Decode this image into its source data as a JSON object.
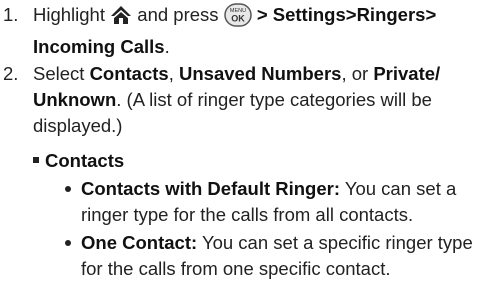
{
  "steps": [
    {
      "number": "1.",
      "text_a": "Highlight",
      "text_b": "and press",
      "separator": ">",
      "path": [
        "Settings",
        "Ringers",
        "Incoming Calls"
      ],
      "end": ".",
      "icons": [
        "home-icon",
        "menu-ok-key-icon"
      ]
    },
    {
      "number": "2.",
      "select_label": "Select",
      "opt1": "Contacts",
      "comma1": ",",
      "opt2": "Unsaved Numbers",
      "or": ", or",
      "opt3": "Private/ Unknown",
      "note": ". (A list of ringer type categories will be displayed.)"
    }
  ],
  "menu_key": {
    "top": "MENU",
    "bottom": "OK"
  },
  "section": {
    "title": "Contacts"
  },
  "sub_items": [
    {
      "term": "Contacts with Default Ringer:",
      "desc": "You can set a ringer type for the calls from all contacts."
    },
    {
      "term": "One Contact:",
      "desc": "You can set a specific ringer type for the calls from one specific contact."
    }
  ]
}
